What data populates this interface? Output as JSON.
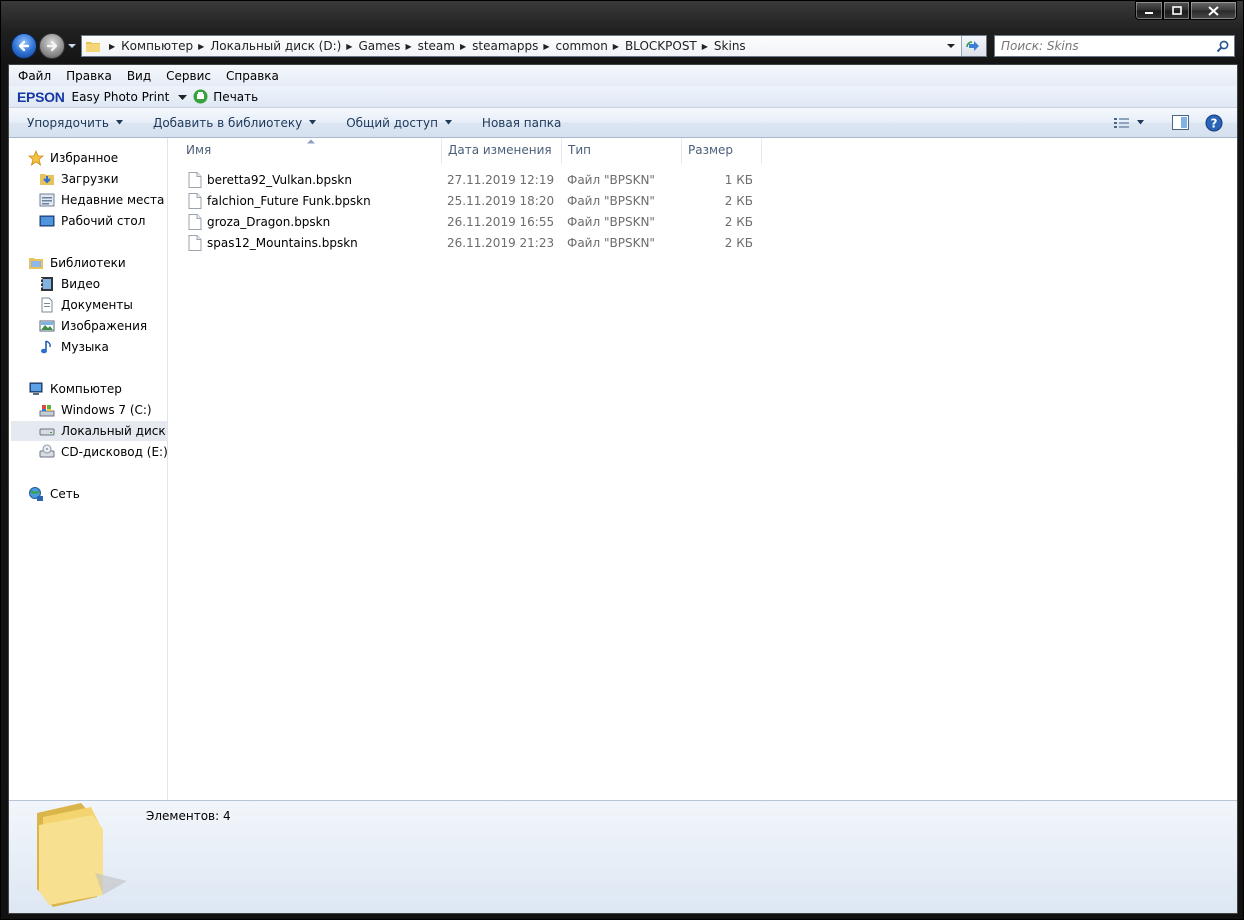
{
  "window": {
    "caption": {
      "minimize": "minimize",
      "maximize": "maximize",
      "close": "close"
    }
  },
  "address_bar": {
    "breadcrumbs": [
      "Компьютер",
      "Локальный диск (D:)",
      "Games",
      "steam",
      "steamapps",
      "common",
      "BLOCKPOST",
      "Skins"
    ]
  },
  "search": {
    "placeholder": "Поиск: Skins"
  },
  "menu": [
    "Файл",
    "Правка",
    "Вид",
    "Сервис",
    "Справка"
  ],
  "epson": {
    "logo": "EPSON",
    "app": "Easy Photo Print",
    "print": "Печать"
  },
  "toolbar": {
    "organize": "Упорядочить",
    "add_to_library": "Добавить в библиотеку",
    "share": "Общий доступ",
    "new_folder": "Новая папка"
  },
  "nav": {
    "favorites": {
      "label": "Избранное",
      "items": [
        "Загрузки",
        "Недавние места",
        "Рабочий стол"
      ]
    },
    "libraries": {
      "label": "Библиотеки",
      "items": [
        "Видео",
        "Документы",
        "Изображения",
        "Музыка"
      ]
    },
    "computer": {
      "label": "Компьютер",
      "items": [
        "Windows 7 (C:)",
        "Локальный диск (D",
        "CD-дисковод (E:)"
      ]
    },
    "network": {
      "label": "Сеть"
    }
  },
  "columns": {
    "name": "Имя",
    "date": "Дата изменения",
    "type": "Тип",
    "size": "Размер"
  },
  "files": [
    {
      "name": "beretta92_Vulkan.bpskn",
      "date": "27.11.2019 12:19",
      "type": "Файл \"BPSKN\"",
      "size": "1 КБ"
    },
    {
      "name": "falchion_Future Funk.bpskn",
      "date": "25.11.2019 18:20",
      "type": "Файл \"BPSKN\"",
      "size": "2 КБ"
    },
    {
      "name": "groza_Dragon.bpskn",
      "date": "26.11.2019 16:55",
      "type": "Файл \"BPSKN\"",
      "size": "2 КБ"
    },
    {
      "name": "spas12_Mountains.bpskn",
      "date": "26.11.2019 21:23",
      "type": "Файл \"BPSKN\"",
      "size": "2 КБ"
    }
  ],
  "details": {
    "item_count": "Элементов: 4"
  },
  "colors": {
    "accent": "#1e395b",
    "selection": "#e5eaf1",
    "epson": "#1638a3"
  }
}
